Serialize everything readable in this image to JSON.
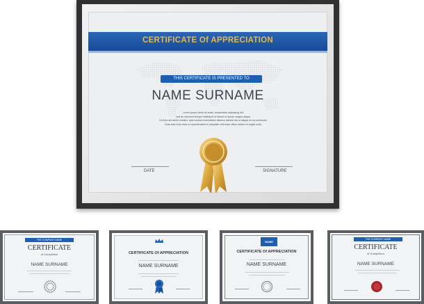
{
  "main": {
    "title": "CERTIFICATE Of APPRECIATION",
    "presented": "THIS CERTIFICATE IS PRESENTED TO",
    "name": "NAME  SURNAME",
    "body_lines": [
      "Lorem ipsum dolor sit amet, consectetur adipiscing elit,",
      "sed do eiusmod tempor incididunt ut labore et dolore magna aliqua.",
      "Ut enim ad minim veniam, quis nostrud exercitation ullamco laboris nisi ut aliquip ex ea commodo.",
      "Duis aute irure dolor in reprehenderit in voluptate velit esse cillum dolore eu fugiat nulla."
    ],
    "date_label": "DATE",
    "signature_label": "SIGNATURE"
  },
  "mini": [
    {
      "company": "THE COMPANY NAME",
      "title": "CERTIFICATE",
      "subtitle": "of Completion",
      "name": "NAME SURNAME"
    },
    {
      "title": "CERTIFICATE Of APPRECIATION",
      "name": "NAME  SURNAME"
    },
    {
      "badge": "NAME",
      "title": "CERTIFICATE Of APPRECIATION",
      "name": "NAME SURNAME"
    },
    {
      "company": "THE COMPANY NAME",
      "title": "CERTIFICATE",
      "subtitle": "of Completion",
      "name": "NAME SURNAME"
    }
  ],
  "colors": {
    "frame": "#2f3133",
    "banner": "#1f5fb0",
    "gold": "#e7b84a",
    "seal_red": "#a5262b"
  }
}
